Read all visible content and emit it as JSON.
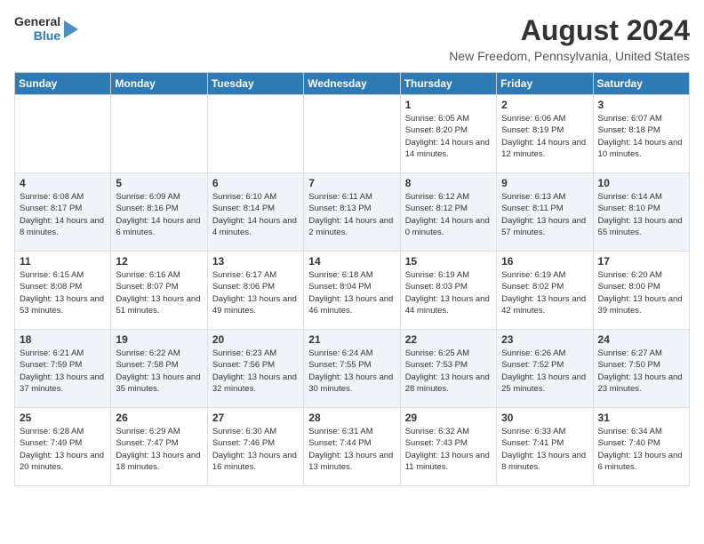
{
  "header": {
    "logo_line1": "General",
    "logo_line2": "Blue",
    "month": "August 2024",
    "location": "New Freedom, Pennsylvania, United States"
  },
  "days_of_week": [
    "Sunday",
    "Monday",
    "Tuesday",
    "Wednesday",
    "Thursday",
    "Friday",
    "Saturday"
  ],
  "weeks": [
    [
      {
        "day": "",
        "info": ""
      },
      {
        "day": "",
        "info": ""
      },
      {
        "day": "",
        "info": ""
      },
      {
        "day": "",
        "info": ""
      },
      {
        "day": "1",
        "info": "Sunrise: 6:05 AM\nSunset: 8:20 PM\nDaylight: 14 hours and 14 minutes."
      },
      {
        "day": "2",
        "info": "Sunrise: 6:06 AM\nSunset: 8:19 PM\nDaylight: 14 hours and 12 minutes."
      },
      {
        "day": "3",
        "info": "Sunrise: 6:07 AM\nSunset: 8:18 PM\nDaylight: 14 hours and 10 minutes."
      }
    ],
    [
      {
        "day": "4",
        "info": "Sunrise: 6:08 AM\nSunset: 8:17 PM\nDaylight: 14 hours and 8 minutes."
      },
      {
        "day": "5",
        "info": "Sunrise: 6:09 AM\nSunset: 8:16 PM\nDaylight: 14 hours and 6 minutes."
      },
      {
        "day": "6",
        "info": "Sunrise: 6:10 AM\nSunset: 8:14 PM\nDaylight: 14 hours and 4 minutes."
      },
      {
        "day": "7",
        "info": "Sunrise: 6:11 AM\nSunset: 8:13 PM\nDaylight: 14 hours and 2 minutes."
      },
      {
        "day": "8",
        "info": "Sunrise: 6:12 AM\nSunset: 8:12 PM\nDaylight: 14 hours and 0 minutes."
      },
      {
        "day": "9",
        "info": "Sunrise: 6:13 AM\nSunset: 8:11 PM\nDaylight: 13 hours and 57 minutes."
      },
      {
        "day": "10",
        "info": "Sunrise: 6:14 AM\nSunset: 8:10 PM\nDaylight: 13 hours and 55 minutes."
      }
    ],
    [
      {
        "day": "11",
        "info": "Sunrise: 6:15 AM\nSunset: 8:08 PM\nDaylight: 13 hours and 53 minutes."
      },
      {
        "day": "12",
        "info": "Sunrise: 6:16 AM\nSunset: 8:07 PM\nDaylight: 13 hours and 51 minutes."
      },
      {
        "day": "13",
        "info": "Sunrise: 6:17 AM\nSunset: 8:06 PM\nDaylight: 13 hours and 49 minutes."
      },
      {
        "day": "14",
        "info": "Sunrise: 6:18 AM\nSunset: 8:04 PM\nDaylight: 13 hours and 46 minutes."
      },
      {
        "day": "15",
        "info": "Sunrise: 6:19 AM\nSunset: 8:03 PM\nDaylight: 13 hours and 44 minutes."
      },
      {
        "day": "16",
        "info": "Sunrise: 6:19 AM\nSunset: 8:02 PM\nDaylight: 13 hours and 42 minutes."
      },
      {
        "day": "17",
        "info": "Sunrise: 6:20 AM\nSunset: 8:00 PM\nDaylight: 13 hours and 39 minutes."
      }
    ],
    [
      {
        "day": "18",
        "info": "Sunrise: 6:21 AM\nSunset: 7:59 PM\nDaylight: 13 hours and 37 minutes."
      },
      {
        "day": "19",
        "info": "Sunrise: 6:22 AM\nSunset: 7:58 PM\nDaylight: 13 hours and 35 minutes."
      },
      {
        "day": "20",
        "info": "Sunrise: 6:23 AM\nSunset: 7:56 PM\nDaylight: 13 hours and 32 minutes."
      },
      {
        "day": "21",
        "info": "Sunrise: 6:24 AM\nSunset: 7:55 PM\nDaylight: 13 hours and 30 minutes."
      },
      {
        "day": "22",
        "info": "Sunrise: 6:25 AM\nSunset: 7:53 PM\nDaylight: 13 hours and 28 minutes."
      },
      {
        "day": "23",
        "info": "Sunrise: 6:26 AM\nSunset: 7:52 PM\nDaylight: 13 hours and 25 minutes."
      },
      {
        "day": "24",
        "info": "Sunrise: 6:27 AM\nSunset: 7:50 PM\nDaylight: 13 hours and 23 minutes."
      }
    ],
    [
      {
        "day": "25",
        "info": "Sunrise: 6:28 AM\nSunset: 7:49 PM\nDaylight: 13 hours and 20 minutes."
      },
      {
        "day": "26",
        "info": "Sunrise: 6:29 AM\nSunset: 7:47 PM\nDaylight: 13 hours and 18 minutes."
      },
      {
        "day": "27",
        "info": "Sunrise: 6:30 AM\nSunset: 7:46 PM\nDaylight: 13 hours and 16 minutes."
      },
      {
        "day": "28",
        "info": "Sunrise: 6:31 AM\nSunset: 7:44 PM\nDaylight: 13 hours and 13 minutes."
      },
      {
        "day": "29",
        "info": "Sunrise: 6:32 AM\nSunset: 7:43 PM\nDaylight: 13 hours and 11 minutes."
      },
      {
        "day": "30",
        "info": "Sunrise: 6:33 AM\nSunset: 7:41 PM\nDaylight: 13 hours and 8 minutes."
      },
      {
        "day": "31",
        "info": "Sunrise: 6:34 AM\nSunset: 7:40 PM\nDaylight: 13 hours and 6 minutes."
      }
    ]
  ]
}
